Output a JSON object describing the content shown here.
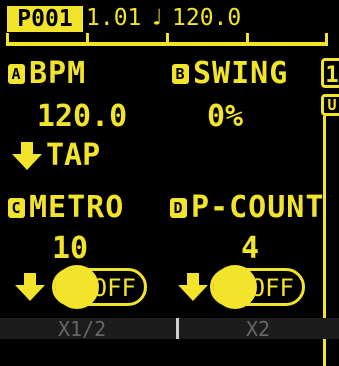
{
  "header": {
    "pattern": "P001",
    "position": "1.01",
    "note_icon": "quarter-note-icon",
    "tempo": "120.0",
    "progress": 0
  },
  "params": {
    "bpm": {
      "badge": "A",
      "label": "BPM",
      "value": "120.0",
      "action": "TAP"
    },
    "swing": {
      "badge": "B",
      "label": "SWING",
      "value": "0%"
    },
    "metro": {
      "badge": "C",
      "label": "METRO",
      "value": "10",
      "toggle": "OFF"
    },
    "pcount": {
      "badge": "D",
      "label": "P-COUNT",
      "value": "4",
      "toggle": "OFF"
    }
  },
  "side": {
    "box1": "1",
    "box2": "U"
  },
  "footer": {
    "left": "X1/2",
    "right": "X2"
  },
  "colors": {
    "accent": "#f2e32b",
    "background": "#000000"
  }
}
